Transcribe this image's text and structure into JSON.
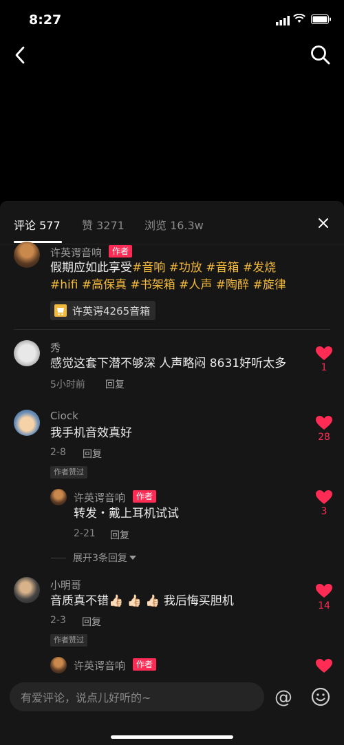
{
  "status": {
    "time": "8:27"
  },
  "tabs": {
    "comments": "评论 577",
    "likes": "赞 3271",
    "views": "浏览 16.3w"
  },
  "post": {
    "author": "许英谔音响",
    "badge": "作者",
    "text_plain": "假期应如此享受",
    "tags_line1": "#音响 #功放 #音箱 #发烧",
    "tags_line2": "#hifi #高保真 #书架箱 #人声 #陶醉 #旋律",
    "product": "许英谔4265音箱"
  },
  "comments": [
    {
      "user": "秀",
      "text": "感觉这套下潜不够深 人声略闷 8631好听太多",
      "time": "5小时前",
      "reply": "回复",
      "likes": "1"
    },
    {
      "user": "Ciock",
      "text": "我手机音效真好",
      "time": "2-8",
      "reply": "回复",
      "chip": "作者赞过",
      "likes": "28",
      "sub": {
        "user": "许英谔音响",
        "badge": "作者",
        "text": "转发・戴上耳机试试",
        "time": "2-21",
        "reply": "回复",
        "likes": "3"
      },
      "expand": "展开3条回复"
    },
    {
      "user": "小明哥",
      "text": "音质真不错👍🏻 👍🏻 👍🏻  我后悔买胆机",
      "time": "2-3",
      "reply": "回复",
      "chip": "作者赞过",
      "likes": "14",
      "sub": {
        "user": "许英谔音响",
        "badge": "作者"
      }
    }
  ],
  "composer": {
    "placeholder": "有爱评论，说点儿好听的~",
    "at": "@"
  },
  "colors": {
    "accent": "#fe2c55",
    "tag": "#f3b93b"
  }
}
